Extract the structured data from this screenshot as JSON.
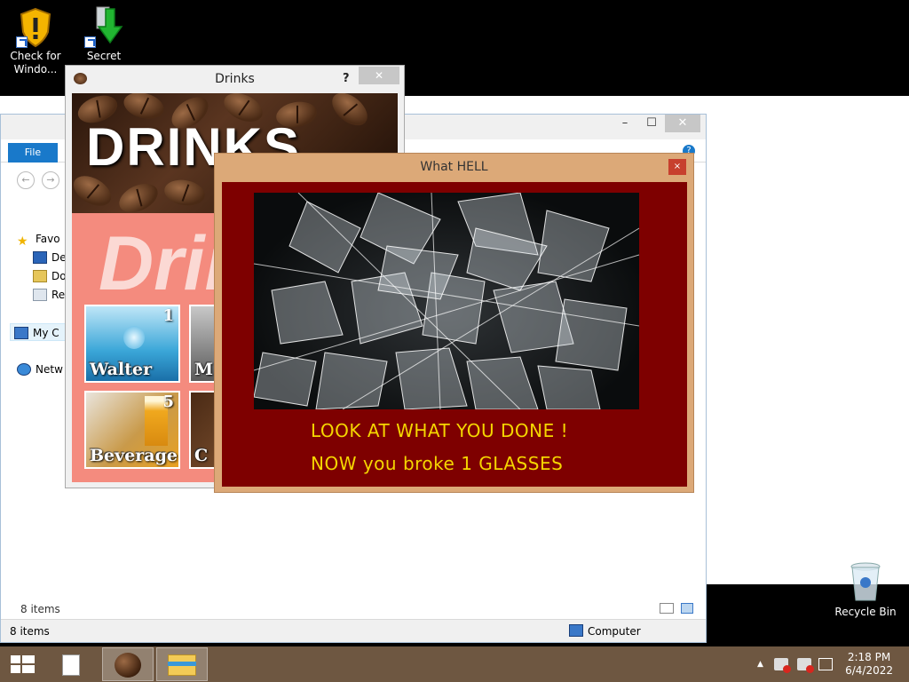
{
  "desktop": {
    "icons": [
      {
        "label_line1": "Check for",
        "label_line2": "Windo..."
      },
      {
        "label_line1": "Secret",
        "label_line2": ""
      }
    ],
    "recycle_bin": "Recycle Bin"
  },
  "explorer": {
    "file_tab": "File",
    "nav_items": [
      "Favo",
      "De",
      "Do",
      "Re",
      "My C",
      "Netw"
    ],
    "inner_status": "8 items",
    "status_count": "8 items",
    "status_location": "Computer"
  },
  "drinks_window": {
    "title": "Drinks",
    "help": "?",
    "close": "✕",
    "banner_title": "DRINKS",
    "pink_title": "Drin",
    "tiles": [
      {
        "label": "Walter",
        "number": "1"
      },
      {
        "label": "M",
        "number": ""
      },
      {
        "label": "Beverage",
        "number": "5"
      },
      {
        "label": "C",
        "number": ""
      }
    ]
  },
  "hell_dialog": {
    "title": "What HELL",
    "close": "×",
    "line1": "LOOK AT WHAT YOU DONE !",
    "line2": "NOW you broke 1 GLASSES",
    "colors": {
      "background": "#7e0000",
      "text": "#f5d600",
      "frame": "#dca978"
    }
  },
  "taskbar": {
    "time": "2:18 PM",
    "date": "6/4/2022"
  }
}
